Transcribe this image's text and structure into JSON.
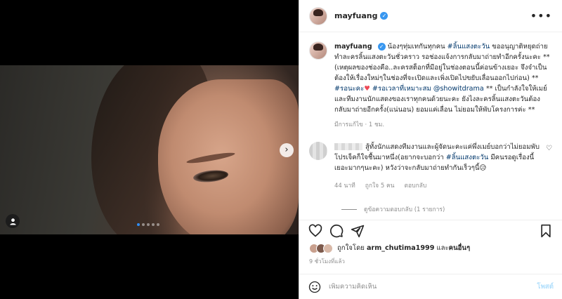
{
  "header": {
    "username": "mayfuang",
    "more_label": "•••"
  },
  "caption": {
    "username": "mayfuang",
    "part1": "น้องๆทุ่มเทกันทุกคน ",
    "hashtag1": "#ลิ้นแสงตะวัน",
    "part2": " ขออนุญาติหยุดถ่ายทำละครลิ้นแสงตะวันชั่วคราว รอช่องแจ้งการกลับมาถ่ายทำอีกครั้งนะคะ **(เหตุผลของช่องคือ..ละครสต็อกที่มีอยู่ในช่องตอนนี้ค่อนข้างเยอะ จึงจำเป็นต้องให้เรื่องใหม่ๆในช่องที่จะเปิดและเพิ่งเปิดไปขยับเลื่อนออกไปก่อน) ** ",
    "hashtag2": "#รอนะคะ",
    "heart": "♥",
    "hashtag3": " #รอเวลาที่เหมาะสม",
    "mention": " @showitdrama",
    "part3": " ** เป็นกำลังใจให้เมย์และทีมงานนักแสดงของเราทุกคนด้วยนะคะ ยังไงละครลิ้นแสงตะวันต้องกลับมาถ่ายอีกครั้ง(แน่นอน) ยอมแค่เลื่อน ไม่ยอมให้พับโครงการค่ะ **",
    "meta": "มีการแก้ไข · 1 ชม."
  },
  "comment": {
    "text1": "สู้ทั้งนักแสดงทีมงานและผู้จัดนะคะแค่พึ่งเมย์บอกว่าไม่ยอมพับโปรเจ็คก็ใจชื้นมาหนึ่ง(อยากจะบอกว่า ",
    "hashtag": "#ลิ้นแสงตะวัน",
    "text2": " มีคนรอดูเรื่องนี้เยอะมากๆนะคะ) หวังว่าจะกลับมาถ่ายทำกันเร็วๆนี้",
    "emoji": "😥",
    "time": "44 นาที",
    "likes": "ถูกใจ 5 คน",
    "reply": "ตอบกลับ",
    "view_replies": "ดูข้อความตอบกลับ (1 รายการ)"
  },
  "likes": {
    "prefix": "ถูกใจโดย ",
    "user": "arm_chutima1999",
    "middle": " และ",
    "others": "คนอื่นๆ"
  },
  "time_ago": "9 ชั่วโมงที่แล้ว",
  "add_comment": {
    "placeholder": "เพิ่มความคิดเห็น",
    "post_label": "โพสต์"
  },
  "carousel": {
    "next_symbol": "›",
    "dots": 5,
    "active_dot": 0
  },
  "colors": {
    "link": "#00376b",
    "verified": "#3897f0",
    "active_dot": "#2f8ef7",
    "post_button": "#b2dffc",
    "heart": "#ed4956"
  }
}
